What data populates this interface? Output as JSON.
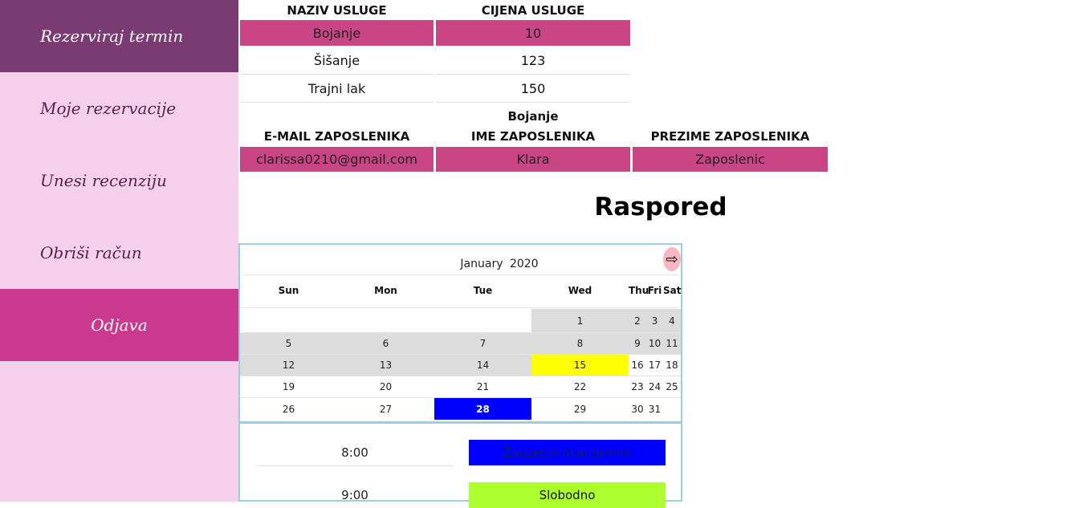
{
  "sidebar": {
    "items": [
      {
        "label": "Rezerviraj termin"
      },
      {
        "label": "Moje rezervacije"
      },
      {
        "label": "Unesi recenziju"
      },
      {
        "label": "Obriši račun"
      },
      {
        "label": "Odjava"
      }
    ]
  },
  "services": {
    "headers": [
      "NAZIV USLUGE",
      "CIJENA USLUGE"
    ],
    "rows": [
      {
        "name": "Bojanje",
        "price": "10"
      },
      {
        "name": "Šišanje",
        "price": "123"
      },
      {
        "name": "Trajni lak",
        "price": "150"
      }
    ]
  },
  "employee": {
    "service_label": "Bojanje",
    "headers": [
      "E-MAIL ZAPOSLENIKA",
      "IME ZAPOSLENIKA",
      "PREZIME ZAPOSLENIKA"
    ],
    "row": {
      "email": "clarissa0210@gmail.com",
      "first_name": "Klara",
      "last_name": "Zaposlenic"
    }
  },
  "schedule": {
    "title": "Raspored"
  },
  "calendar": {
    "month": "January",
    "year": "2020",
    "next_icon": "arrow-right-icon",
    "days_of_week": [
      "Sun",
      "Mon",
      "Tue",
      "Wed",
      "Thu",
      "Fri",
      "Sat"
    ],
    "weeks": [
      [
        "",
        "",
        "",
        "1",
        "2",
        "3",
        "4"
      ],
      [
        "5",
        "6",
        "7",
        "8",
        "9",
        "10",
        "11"
      ],
      [
        "12",
        "13",
        "14",
        "15",
        "16",
        "17",
        "18"
      ],
      [
        "19",
        "20",
        "21",
        "22",
        "23",
        "24",
        "25"
      ],
      [
        "26",
        "27",
        "28",
        "29",
        "30",
        "31",
        ""
      ]
    ],
    "colors": {
      "highlight": "#ffff00",
      "selected": "#0000ff",
      "past": "#dcdcdc"
    }
  },
  "slots": [
    {
      "time": "8:00",
      "status": "Zauzet si ovaj termin",
      "color": "#0000ff"
    },
    {
      "time": "9:00",
      "status": "Slobodno",
      "color": "#adff2f"
    }
  ]
}
